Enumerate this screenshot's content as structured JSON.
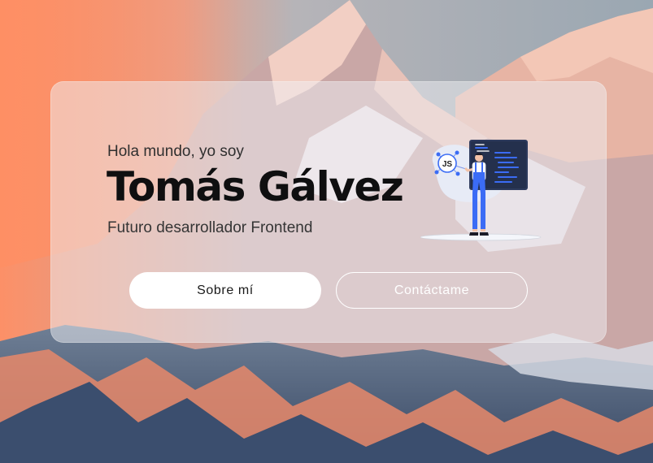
{
  "hero": {
    "greeting": "Hola mundo, yo soy",
    "name": "Tomás Gálvez",
    "role": "Futuro desarrollador Frontend"
  },
  "buttons": {
    "about_label": "Sobre mí",
    "contact_label": "Contáctame"
  },
  "illustration": {
    "badge_text": "JS",
    "icon": "developer-presenting-code-illustration"
  },
  "colors": {
    "accent_blue": "#3b6cf5",
    "button_bg": "#ffffff",
    "card_glass": "rgba(240,240,244,0.5)"
  }
}
